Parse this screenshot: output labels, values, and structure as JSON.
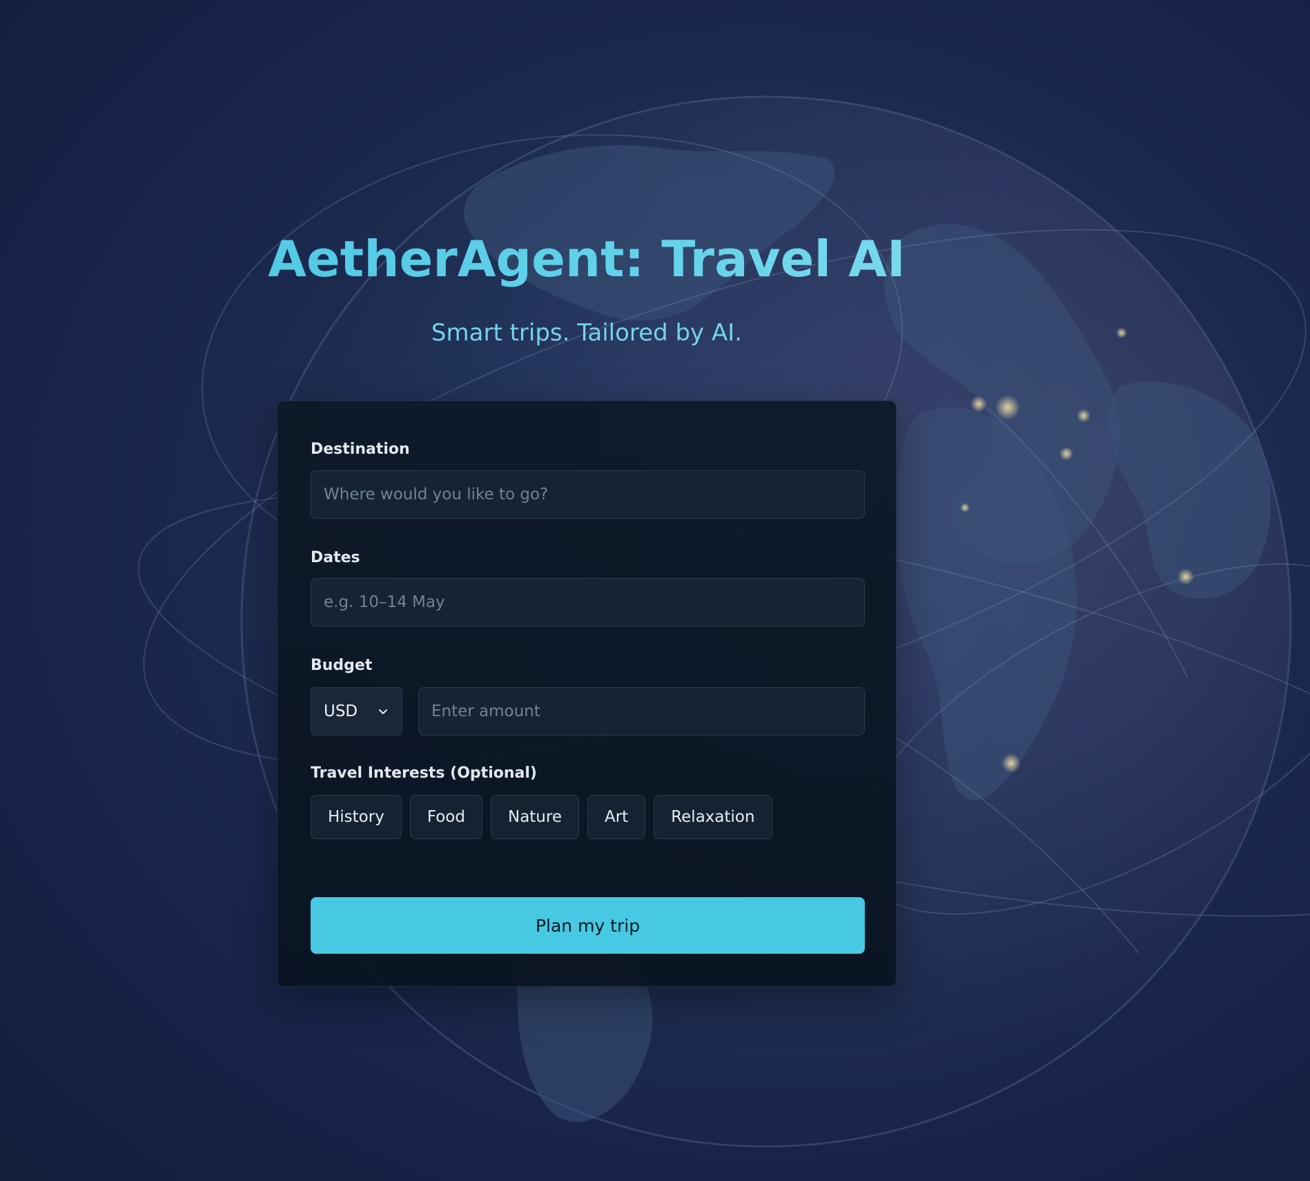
{
  "header": {
    "title": "AetherAgent: Travel AI",
    "subtitle": "Smart trips. Tailored by AI."
  },
  "form": {
    "destination": {
      "label": "Destination",
      "placeholder": "Where would you like to go?",
      "value": ""
    },
    "dates": {
      "label": "Dates",
      "placeholder": "e.g. 10–14 May",
      "value": ""
    },
    "budget": {
      "label": "Budget",
      "currency": "USD",
      "amount_placeholder": "Enter amount",
      "amount_value": ""
    },
    "interests": {
      "label": "Travel Interests (Optional)",
      "chips": [
        "History",
        "Food",
        "Nature",
        "Art",
        "Relaxation"
      ]
    },
    "submit_label": "Plan my trip"
  },
  "icons": {
    "currency_dropdown": "chevron-down-icon"
  },
  "colors": {
    "accent": "#47c9e3",
    "title": "#5ccde6",
    "subtitle": "#74d3ea",
    "card_bg": "#0d1826",
    "input_bg": "#152334",
    "page_bg": "#1b2848"
  }
}
